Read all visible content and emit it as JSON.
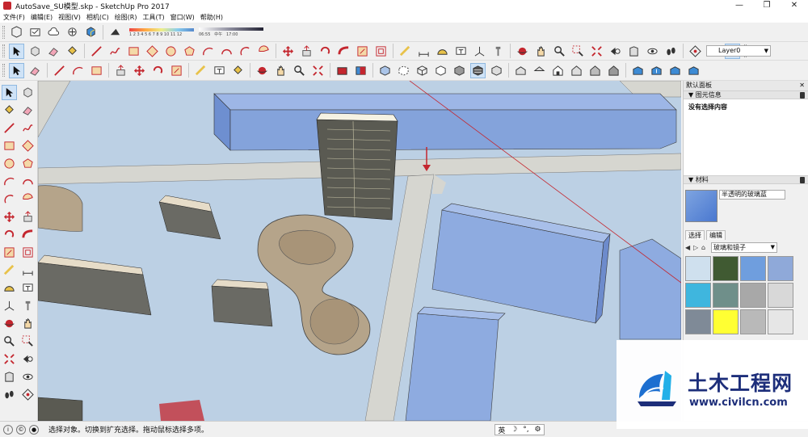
{
  "window": {
    "title": "AutoSave_SU模型.skp - SketchUp Pro 2017",
    "controls": [
      "—",
      "❐",
      "✕"
    ]
  },
  "menu": [
    "文件(F)",
    "编辑(E)",
    "视图(V)",
    "相机(C)",
    "绘图(R)",
    "工具(T)",
    "窗口(W)",
    "帮助(H)"
  ],
  "shadow": {
    "time_ticks": "1 2 3 4 5 6 7 8 9 10 11 12",
    "date_label": "06:55",
    "noon_label": "中午",
    "end_label": "17:00"
  },
  "layer": {
    "current": "Layer0"
  },
  "tray": {
    "title": "默认面板",
    "entity_info": {
      "header": "图元信息",
      "text": "没有选择内容"
    },
    "materials": {
      "header": "材料",
      "current_name": "半透明的玻璃蓝",
      "tabs": [
        "选择",
        "编辑"
      ],
      "library": "玻璃和镜子",
      "swatch_colors": [
        "#cfe0ee",
        "#405a32",
        "#6f9ede",
        "#8fa9d9",
        "#3fb6de",
        "#6f8f8a",
        "#a8a8a8",
        "#d8d8d8",
        "#7f8a97",
        "#ffff33",
        "#b9b9b9",
        "#e6e6e6"
      ]
    }
  },
  "status": {
    "text": "选择对象。切换到扩充选择。拖动鼠标选择多项。",
    "ime": [
      "英",
      "☽",
      "°,",
      "⚙"
    ]
  },
  "watermark": {
    "cn": "土木工程网",
    "url": "www.civilcn.com"
  },
  "colors": {
    "accent": "#c4262e",
    "sky_ground": "#bcd0e4",
    "road": "#d6d6d0",
    "building_glass": "#7f9fdb"
  }
}
